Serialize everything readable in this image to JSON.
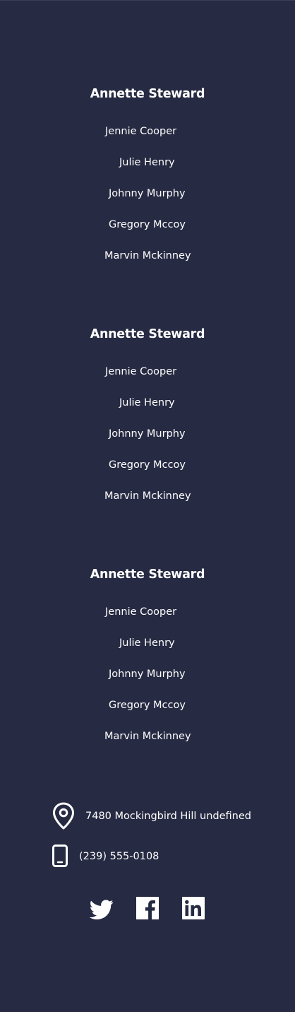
{
  "columns": [
    {
      "title": "Annette Steward",
      "links": [
        "Jennie Cooper",
        "Julie Henry",
        "Johnny Murphy",
        "Gregory Mccoy",
        "Marvin Mckinney"
      ]
    },
    {
      "title": "Annette Steward",
      "links": [
        "Jennie Cooper",
        "Julie Henry",
        "Johnny Murphy",
        "Gregory Mccoy",
        "Marvin Mckinney"
      ]
    },
    {
      "title": "Annette Steward",
      "links": [
        "Jennie Cooper",
        "Julie Henry",
        "Johnny Murphy",
        "Gregory Mccoy",
        "Marvin Mckinney"
      ]
    }
  ],
  "contact": {
    "address": "7480 Mockingbird Hill undefined",
    "phone": "(239) 555-0108",
    "address_icon": "location-pin-icon",
    "phone_icon": "mobile-phone-icon"
  },
  "social": [
    {
      "name": "twitter",
      "icon": "twitter-icon"
    },
    {
      "name": "facebook",
      "icon": "facebook-icon"
    },
    {
      "name": "linkedin",
      "icon": "linkedin-icon"
    }
  ],
  "colors": {
    "background": "#262a42",
    "text": "#ffffff"
  }
}
